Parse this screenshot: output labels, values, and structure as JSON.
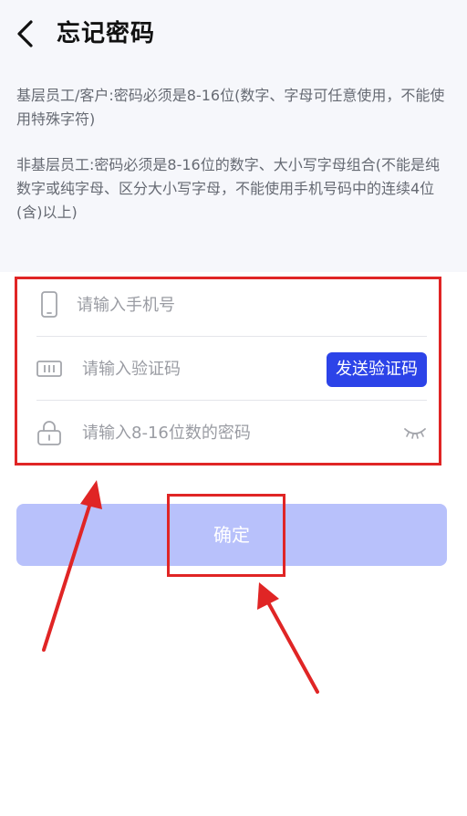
{
  "header": {
    "title": "忘记密码"
  },
  "rules": {
    "basic_staff": "基层员工/客户:密码必须是8-16位(数字、字母可任意使用，不能使用特殊字符)",
    "non_basic_staff": "非基层员工:密码必须是8-16位的数字、大小写字母组合(不能是纯数字或纯字母、区分大小写字母，不能使用手机号码中的连续4位(含)以上)"
  },
  "form": {
    "phone": {
      "placeholder": "请输入手机号",
      "value": ""
    },
    "code": {
      "placeholder": "请输入验证码",
      "value": "",
      "send_label": "发送验证码"
    },
    "password": {
      "placeholder": "请输入8-16位数的密码",
      "value": ""
    }
  },
  "confirm": {
    "label": "确定"
  },
  "colors": {
    "accent": "#2c43e8",
    "confirm_disabled": "#b8c1fb",
    "annotation_red": "#e02525",
    "top_background": "#f6f7fb"
  },
  "icons": {
    "back": "chevron-left-icon",
    "phone": "phone-icon",
    "code": "verification-code-icon",
    "password": "lock-icon",
    "password_toggle": "eye-closed-icon"
  }
}
